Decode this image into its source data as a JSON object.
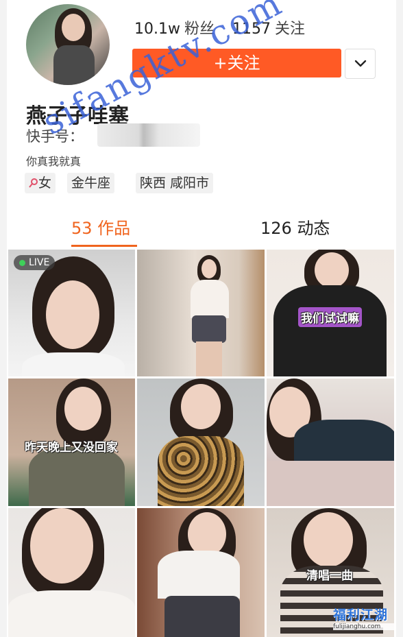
{
  "profile": {
    "fans_count": "10.1w",
    "fans_label": "粉丝",
    "following_count": "1157",
    "following_label": "关注",
    "follow_button": "+关注",
    "nickname": "燕子子哇塞",
    "ks_id_label": "快手号：",
    "bio": "你真我就真",
    "tags": {
      "gender_icon": "female-icon",
      "gender": "女",
      "zodiac": "金牛座",
      "location": "陕西 咸阳市"
    }
  },
  "tabs": [
    {
      "label": "53 作品",
      "active": true
    },
    {
      "label": "126 动态",
      "active": false
    }
  ],
  "grid": {
    "live_label": "LIVE",
    "captions": {
      "c3": "我们试试嘛",
      "c4": "昨天晚上又没回家",
      "c9": "清唱一曲"
    }
  },
  "watermark": {
    "text": "sifangktv.com",
    "corner_brand": "福利江湖",
    "corner_domain": "fulijianghu.com"
  },
  "colors": {
    "accent": "#ff5a25",
    "tab_active": "#f0641e",
    "watermark": "#3a62d8"
  }
}
